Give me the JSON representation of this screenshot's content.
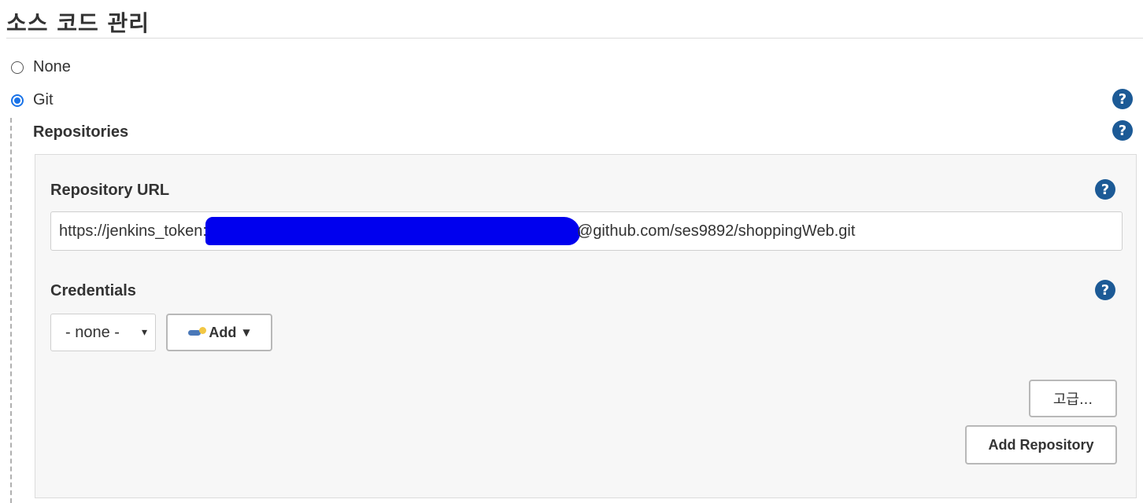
{
  "section": {
    "title": "소스 코드 관리"
  },
  "scm": {
    "options": [
      {
        "label": "None",
        "selected": false
      },
      {
        "label": "Git",
        "selected": true
      }
    ]
  },
  "git": {
    "repositories_label": "Repositories",
    "repository_url_label": "Repository URL",
    "repository_url_prefix": "https://jenkins_token:",
    "repository_url_suffix": "@github.com/ses9892/shoppingWeb.git",
    "credentials_label": "Credentials",
    "credentials_selected": "- none -",
    "add_button_label": "Add",
    "advanced_button_label": "고급...",
    "add_repository_button_label": "Add Repository"
  },
  "icons": {
    "help": "help-circle-icon",
    "key": "key-icon",
    "dropdown": "chevron-down-icon"
  },
  "colors": {
    "help_icon": "#1c5a96",
    "radio_selected": "#1a73e8",
    "redaction": "#0000ee"
  }
}
